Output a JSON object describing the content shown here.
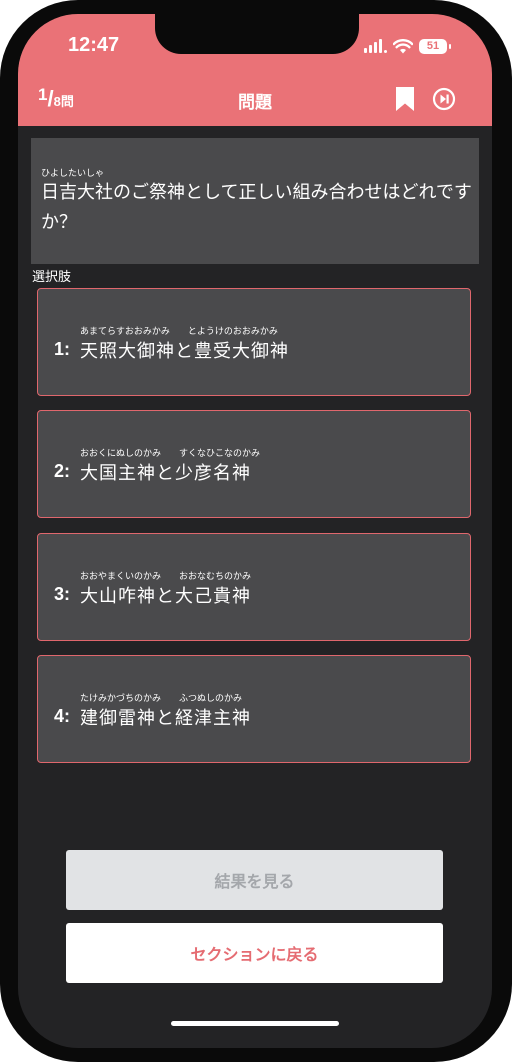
{
  "status_bar": {
    "time": "12:47",
    "battery": "51",
    "icons": [
      "signal-icon",
      "wifi-icon",
      "battery-icon"
    ]
  },
  "header": {
    "progress_current": "1",
    "progress_slash": "/",
    "progress_total": "8問",
    "title": "問題",
    "icons": [
      "bookmark-icon",
      "skip-icon"
    ]
  },
  "question": {
    "ruby": "ひよしたいしゃ",
    "text": "日吉大社のご祭神として正しい組み合わせはどれですか？"
  },
  "choices_label": "選択肢",
  "choices": [
    {
      "number": "1:",
      "ruby": "あまてらすおおみかみ　　とようけのおおみかみ",
      "text": "天照大御神と豊受大御神"
    },
    {
      "number": "2:",
      "ruby": "おおくにぬしのかみ　　すくなひこなのかみ",
      "text": "大国主神と少彦名神"
    },
    {
      "number": "3:",
      "ruby": "おおやまくいのかみ　　おおなむちのかみ",
      "text": "大山咋神と大己貴神"
    },
    {
      "number": "4:",
      "ruby": "たけみかづちのかみ　　ふつぬしのかみ",
      "text": "建御雷神と経津主神"
    }
  ],
  "buttons": {
    "results": "結果を見る",
    "back": "セクションに戻る"
  },
  "colors": {
    "accent": "#ea7277",
    "background": "#232325",
    "panel": "#4a4a4c",
    "choice_border": "#e0676d"
  }
}
